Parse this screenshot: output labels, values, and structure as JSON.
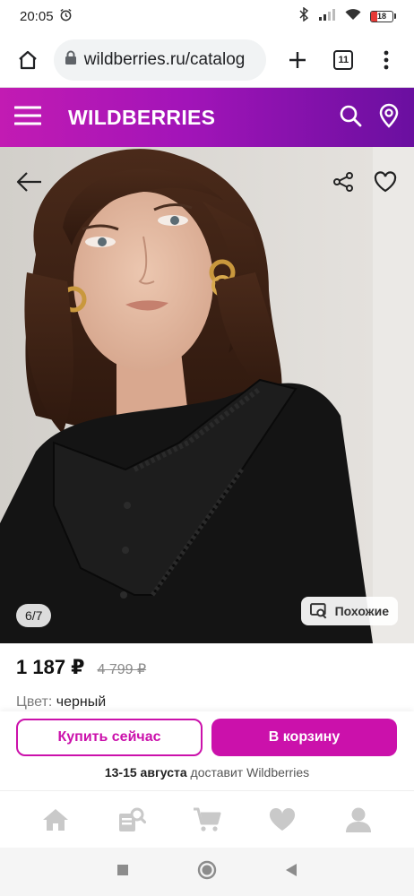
{
  "status_bar": {
    "time": "20:05",
    "battery": "18"
  },
  "browser": {
    "url": "wildberries.ru/catalog",
    "tab_count": "11"
  },
  "header": {
    "logo": "WILDBERRIES"
  },
  "gallery": {
    "counter": "6/7",
    "similar_label": "Похожие"
  },
  "product": {
    "price": "1 187 ₽",
    "old_price": "4 799 ₽",
    "color_label": "Цвет:",
    "color_value": "черный"
  },
  "actions": {
    "buy_now": "Купить сейчас",
    "add_to_cart": "В корзину"
  },
  "delivery": {
    "dates": "13-15 августа",
    "text": "доставит Wildberries"
  },
  "colors": {
    "brand": "#cb11ab",
    "header_start": "#c21bb3",
    "header_end": "#6a0fa0"
  },
  "icons": [
    "home-icon",
    "catalog-search-icon",
    "cart-icon",
    "heart-icon",
    "profile-icon"
  ]
}
